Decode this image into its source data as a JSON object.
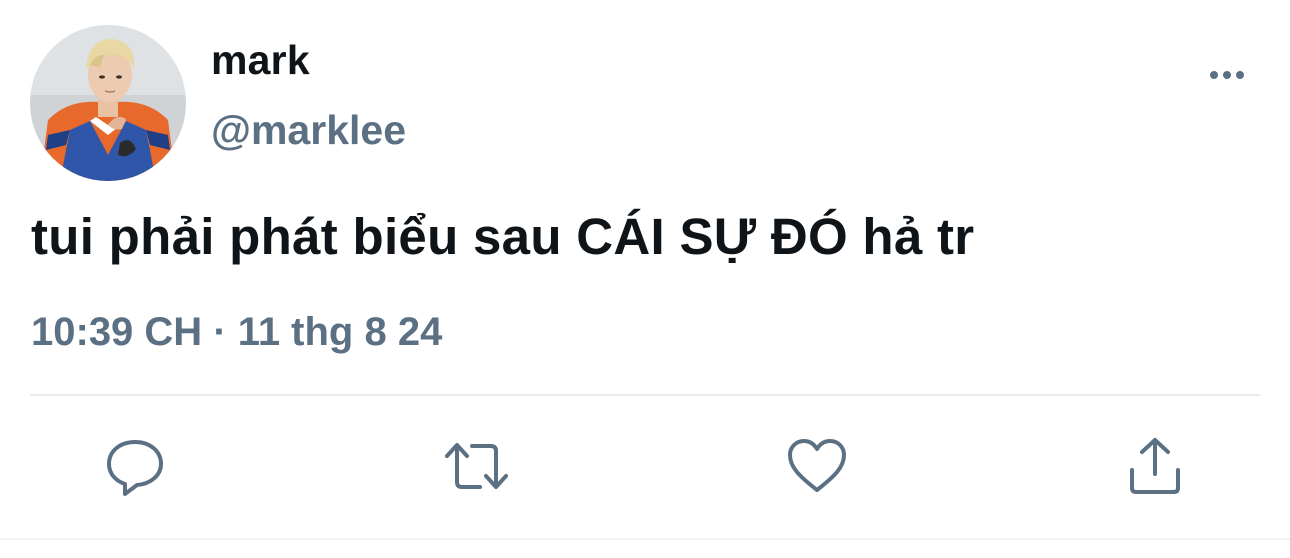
{
  "author": {
    "display_name": "mark",
    "handle": "@marklee",
    "avatar_icon": "profile-photo"
  },
  "tweet": {
    "text": "tui phải phát biểu sau CÁI SỰ ĐÓ hả tr",
    "time": "10:39 CH",
    "separator": "·",
    "date": "11 thg 8 24"
  },
  "actions": {
    "reply_icon": "speech-bubble-icon",
    "retweet_icon": "retweet-arrows-icon",
    "like_icon": "heart-icon",
    "share_icon": "share-upload-icon",
    "more_icon": "ellipsis-icon"
  },
  "colors": {
    "text_primary": "#0f1419",
    "text_secondary": "#5b7083",
    "icon": "#5b7083",
    "divider": "#e6ecf0"
  }
}
